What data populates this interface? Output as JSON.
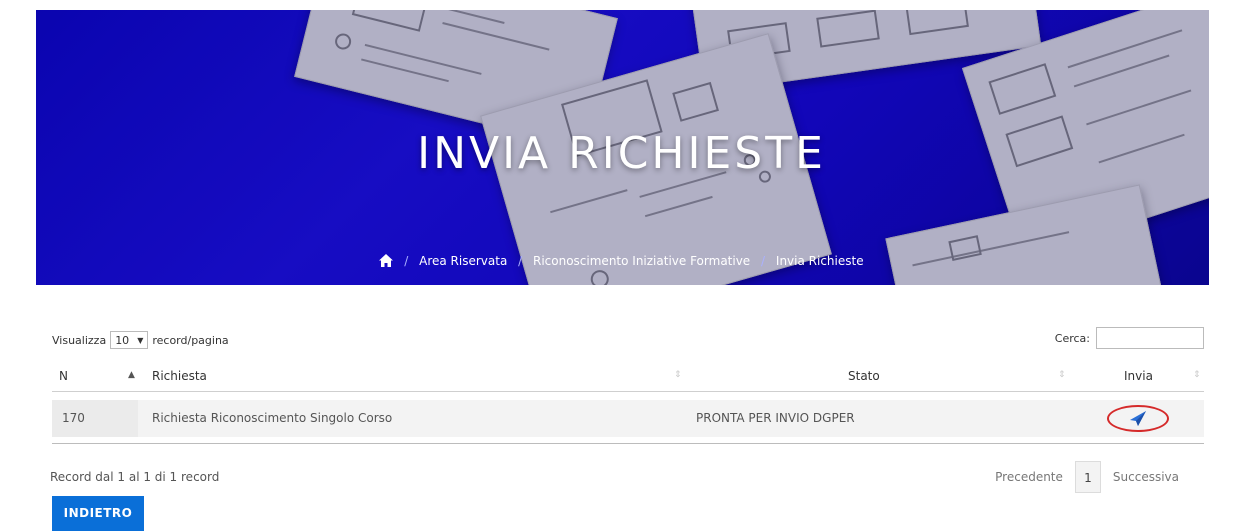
{
  "hero": {
    "title": "INVIA RICHIESTE",
    "colors": {
      "banner": "#1407c4",
      "title": "#ffffff"
    }
  },
  "breadcrumb": {
    "home_icon": "home-icon",
    "items": [
      "Area Riservata",
      "Riconoscimento Iniziative Formative",
      "Invia Richieste"
    ],
    "separator": "/"
  },
  "controls": {
    "show_label": "Visualizza",
    "page_size": "10",
    "per_page_label": "record/pagina",
    "search_label": "Cerca:",
    "search_value": ""
  },
  "table": {
    "columns": [
      "N",
      "Richiesta",
      "Stato",
      "Invia"
    ],
    "sorted_column": "N",
    "rows": [
      {
        "n": "170",
        "richiesta": "Richiesta Riconoscimento Singolo Corso",
        "stato": "PRONTA PER INVIO DGPER",
        "invia_icon": "send-icon"
      }
    ]
  },
  "footer": {
    "info": "Record dal 1 al 1 di 1 record",
    "prev": "Precedente",
    "page": "1",
    "next": "Successiva",
    "back_button": "INDIETRO",
    "colors": {
      "back_button": "#0a6fd8",
      "highlight_ring": "#d52a2a"
    }
  }
}
